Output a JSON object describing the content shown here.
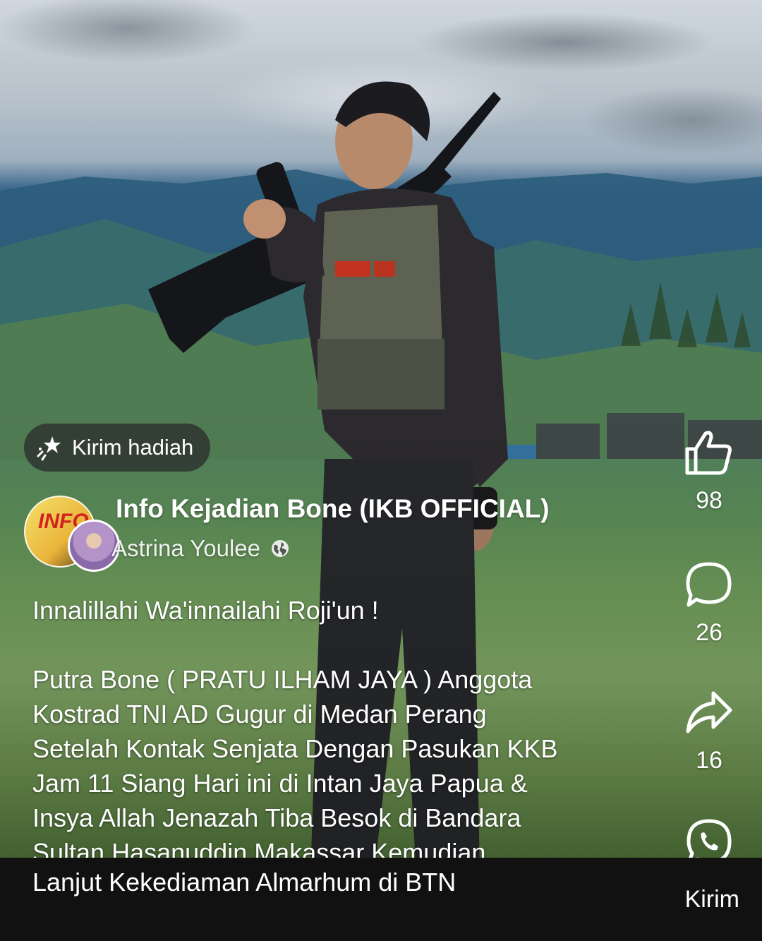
{
  "gift_button": {
    "label": "Kirim hadiah"
  },
  "author": {
    "page_name": "Info Kejadian Bone (IKB OFFICIAL)",
    "page_logo_text": "INFO",
    "user_name": "Astrina Youlee"
  },
  "caption": {
    "line1": "Innalillahi Wa'innailahi Roji'un !",
    "lines": [
      "Putra Bone ( PRATU ILHAM JAYA ) Anggota",
      "Kostrad TNI AD Gugur di Medan Perang",
      "Setelah Kontak Senjata Dengan Pasukan KKB",
      "Jam 11 Siang Hari ini di Intan Jaya Papua &",
      "Insya Allah Jenazah Tiba Besok di Bandara",
      "Sultan Hasanuddin Makassar Kemudian"
    ],
    "last_line": "Lanjut Kekediaman Almarhum di BTN"
  },
  "rail": {
    "like_count": "98",
    "comment_count": "26",
    "share_count": "16",
    "whatsapp_label": "Kirim"
  },
  "icons": {
    "gift": "gift-sparkle-icon",
    "globe": "globe-icon",
    "like": "thumbs-up-icon",
    "comment": "comment-bubble-icon",
    "share": "share-arrow-icon",
    "whatsapp": "whatsapp-icon"
  }
}
